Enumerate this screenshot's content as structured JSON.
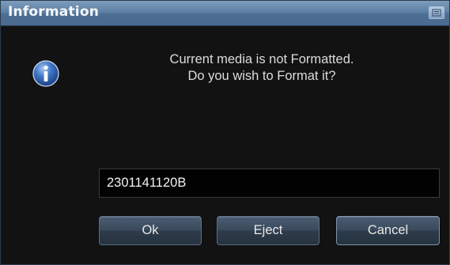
{
  "dialog": {
    "title": "Information",
    "message_line1": "Current media is not Formatted.",
    "message_line2": "Do you wish to Format it?",
    "media_id": "2301141120B",
    "buttons": {
      "ok": "Ok",
      "eject": "Eject",
      "cancel": "Cancel"
    },
    "icon": "info-icon"
  },
  "colors": {
    "titlebar": "#5f81a6",
    "background": "#141414",
    "text": "#dcdcdc",
    "button": "#3a4a5c"
  }
}
